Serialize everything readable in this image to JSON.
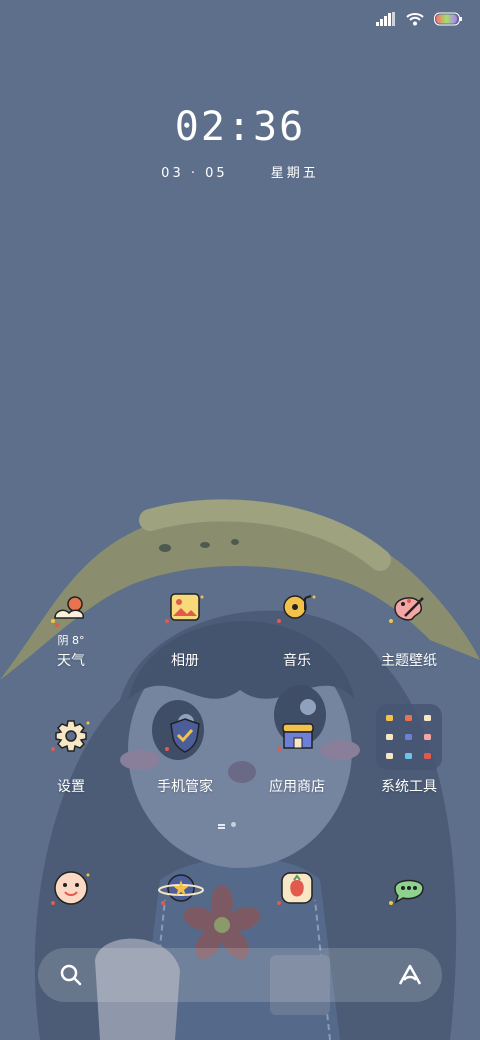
{
  "status": {
    "signal_icon": "signal-icon",
    "wifi_icon": "wifi-icon",
    "battery_icon": "battery-icon",
    "battery_level": 0.9
  },
  "clock": {
    "time": "02:36",
    "date": "03 · 05",
    "weekday": "星期五"
  },
  "apps_row1": [
    {
      "label": "天气",
      "sub": "阴 8°",
      "icon": "weather-icon"
    },
    {
      "label": "相册",
      "icon": "gallery-icon"
    },
    {
      "label": "音乐",
      "icon": "music-icon"
    },
    {
      "label": "主题壁纸",
      "icon": "theme-icon"
    }
  ],
  "apps_row2": [
    {
      "label": "设置",
      "icon": "settings-icon"
    },
    {
      "label": "手机管家",
      "icon": "security-icon"
    },
    {
      "label": "应用商店",
      "icon": "app-store-icon"
    },
    {
      "label": "系统工具",
      "icon": "folder-icon"
    }
  ],
  "dock": [
    {
      "icon": "phone-icon"
    },
    {
      "icon": "browser-icon"
    },
    {
      "icon": "camera-icon"
    },
    {
      "icon": "messages-icon"
    }
  ],
  "search_bar": {
    "search_icon": "search-icon",
    "assistant_icon": "assistant-icon"
  }
}
